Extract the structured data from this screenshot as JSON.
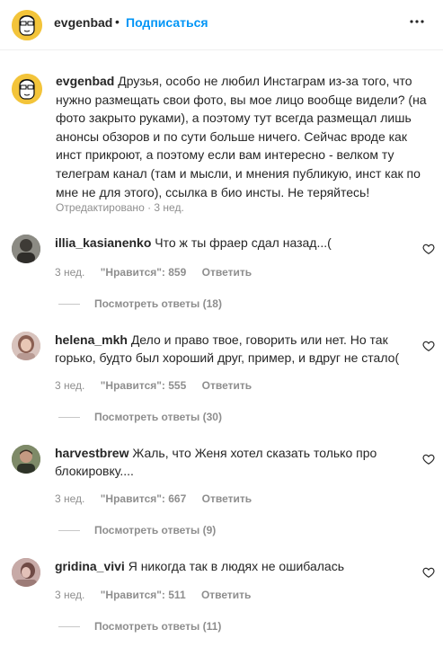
{
  "header": {
    "username": "evgenbad",
    "separator": "•",
    "follow_label": "Подписаться",
    "more_icon": "more-horizontal-icon"
  },
  "caption": {
    "username": "evgenbad",
    "text": "Друзья, особо не любил Инстаграм из-за того, что нужно размещать свои фото, вы мое лицо вообще видели? (на фото закрыто руками), а поэтому тут всегда размещал лишь анонсы обзоров и по сути больше ничего. Сейчас вроде как инст прикроют, а поэтому если вам интересно - велком ту телеграм канал (там и мысли, и мнения публикую, инст как по мне не для этого), ссылка в био инсты. Не теряйтесь!",
    "meta": "Отредактировано · 3 нед."
  },
  "comments": [
    {
      "username": "illia_kasianenko",
      "text": "Что ж ты фраер сдал назад...(",
      "time": "3 нед.",
      "likes": "\"Нравится\": 859",
      "reply_label": "Ответить",
      "view_replies": "Посмотреть ответы (18)",
      "avatar_color": "#5a5a52"
    },
    {
      "username": "helena_mkh",
      "text": "Дело и право твое, говорить или нет. Но так горько, будто был хороший друг, пример, и вдруг не стало(",
      "time": "3 нед.",
      "likes": "\"Нравится\": 555",
      "reply_label": "Ответить",
      "view_replies": "Посмотреть ответы (30)",
      "avatar_color": "#c9a79a"
    },
    {
      "username": "harvestbrew",
      "text": "Жаль, что Женя хотел сказать только про блокировку....",
      "time": "3 нед.",
      "likes": "\"Нравится\": 667",
      "reply_label": "Ответить",
      "view_replies": "Посмотреть ответы (9)",
      "avatar_color": "#6f7a5a"
    },
    {
      "username": "gridina_vivi",
      "text": "Я никогда так в людях не ошибалась",
      "time": "3 нед.",
      "likes": "\"Нравится\": 511",
      "reply_label": "Ответить",
      "view_replies": "Посмотреть ответы (11)",
      "avatar_color": "#b08a86"
    }
  ],
  "colors": {
    "accent": "#0095f6",
    "text": "#262626",
    "muted": "#8e8e8e",
    "avatar_yellow": "#f3c43a"
  }
}
